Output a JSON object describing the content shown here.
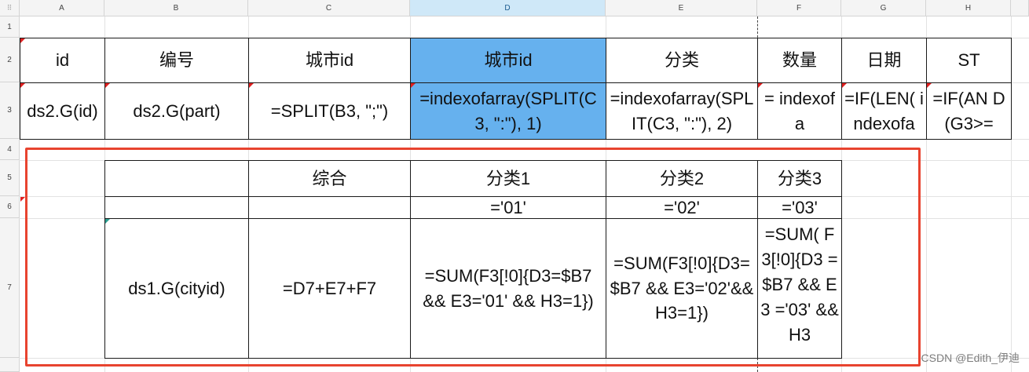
{
  "columns": [
    "A",
    "B",
    "C",
    "D",
    "E",
    "F",
    "G",
    "H"
  ],
  "rows": [
    "1",
    "2",
    "3",
    "4",
    "5",
    "6",
    "7"
  ],
  "header_row": {
    "a": "id",
    "b": "编号",
    "c": "城市id",
    "d": "城市id",
    "e": "分类",
    "f": "数量",
    "g": "日期",
    "h": "ST"
  },
  "data_row": {
    "a": "ds2.G(id)",
    "b": "ds2.G(part)",
    "c": "=SPLIT(B3, \";\")",
    "d": "=indexofarray(SPLIT(C3, \":\"), 1)",
    "e": "=indexofarray(SPLIT(C3, \":\"), 2)",
    "f": "= indexofa",
    "g": "=IF(LEN( indexofa",
    "h": "=IF(AN D(G3>="
  },
  "summary_header": {
    "c": "综合",
    "d": "分类1",
    "e": "分类2",
    "f": "分类3"
  },
  "summary_codes": {
    "d": "='01'",
    "e": "='02'",
    "f": "='03'"
  },
  "summary_row": {
    "b": "ds1.G(cityid)",
    "c": "=D7+E7+F7",
    "d": "=SUM(F3[!0]{D3=$B7 && E3='01' && H3=1})",
    "e": "=SUM(F3[!0]{D3=$B7 && E3='02'&& H3=1})",
    "f": "=SUM( F3[!0]{D3 =$B7 && E3 ='03' && H3"
  },
  "watermark": "CSDN @Edith_伊迪",
  "colors": {
    "selected_cell": "#66b1ee",
    "frame": "#e8432f",
    "active_column_header": "#cfe8f8"
  }
}
